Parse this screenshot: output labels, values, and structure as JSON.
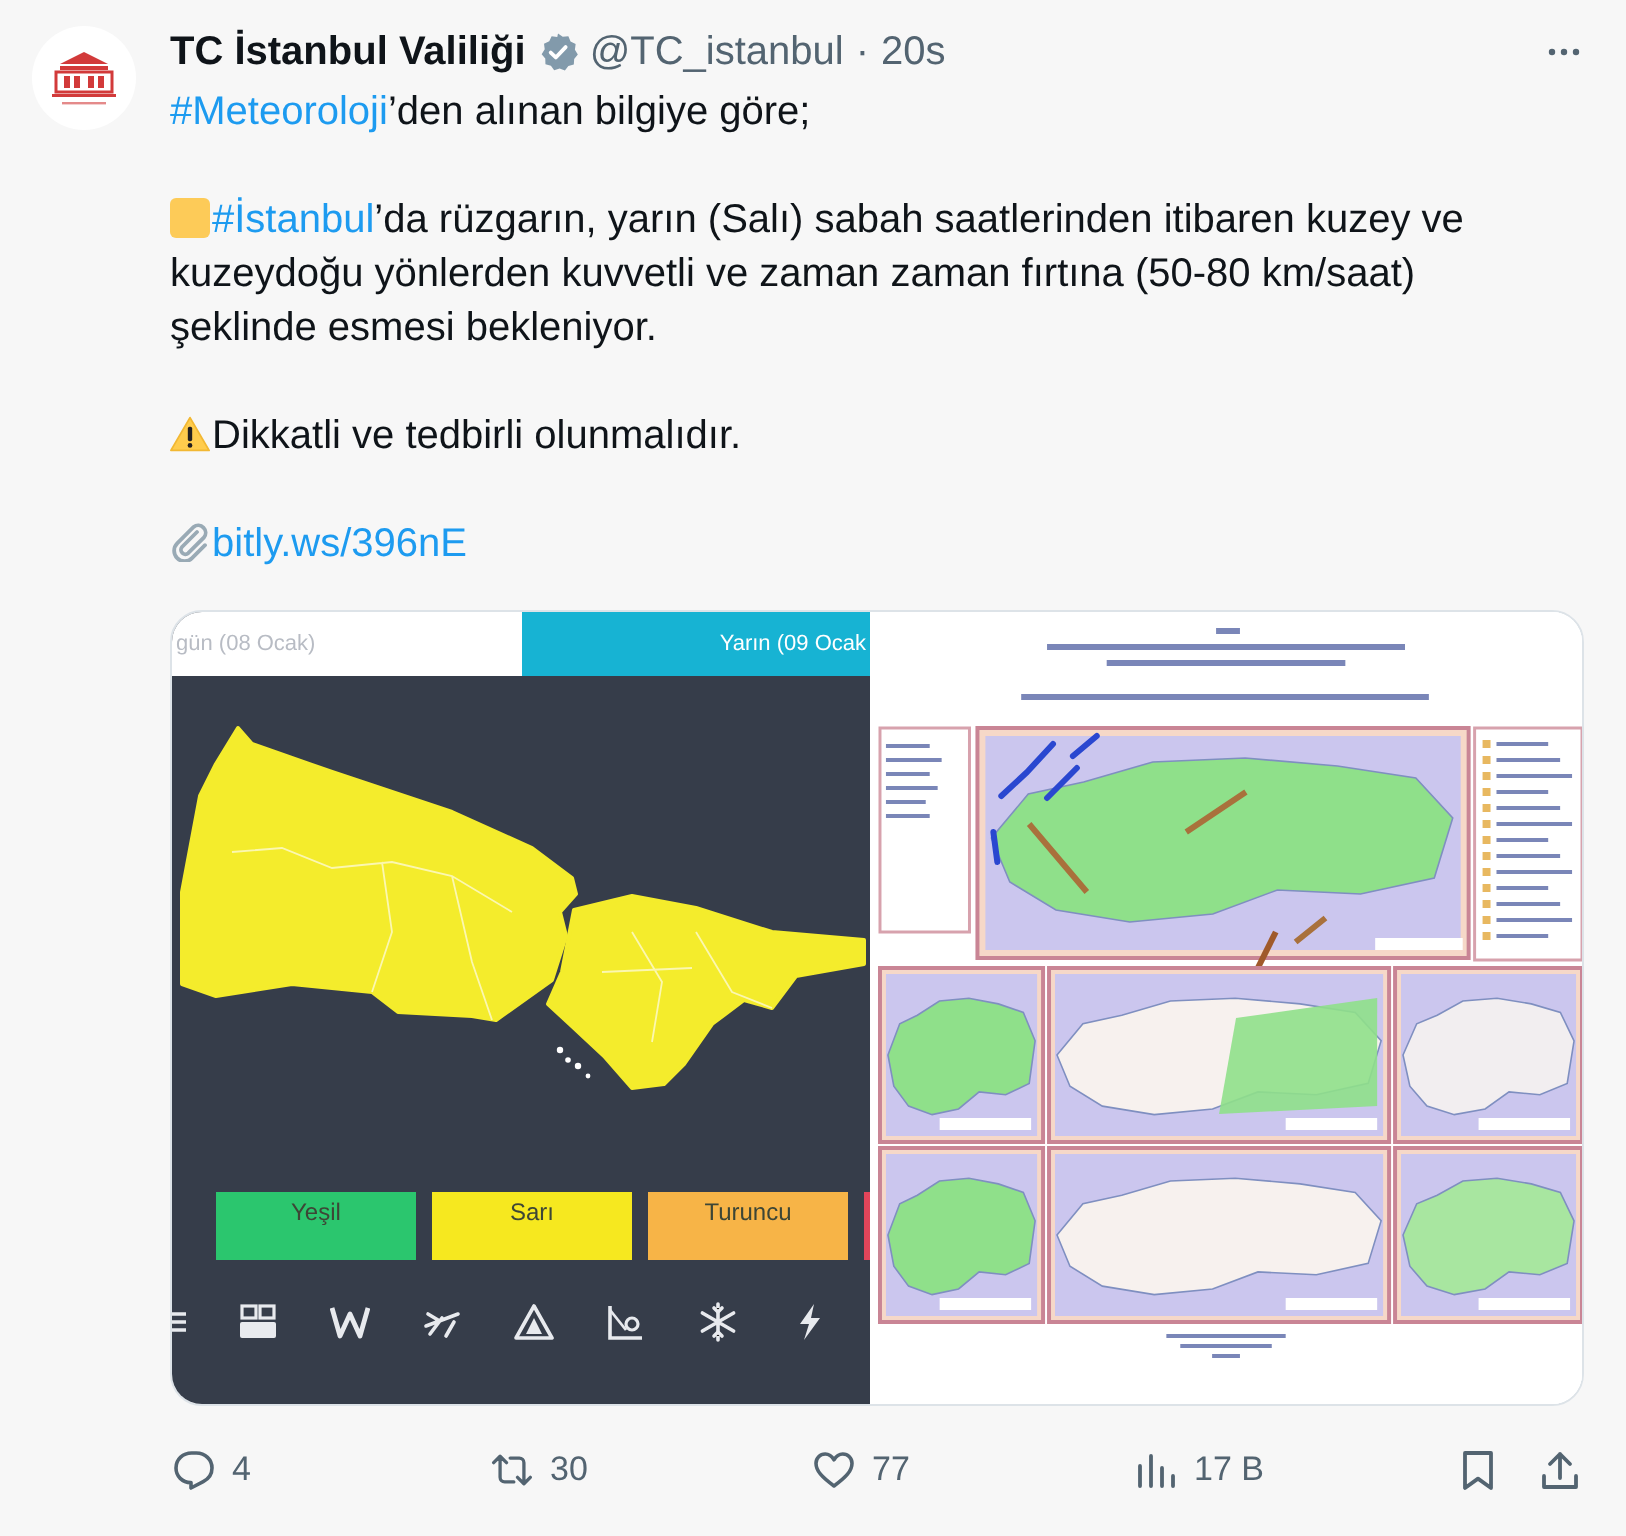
{
  "author": {
    "name": "TC İstanbul Valiliği",
    "verified": true,
    "handle": "@TC_istanbul",
    "separator": "·",
    "time": "20s"
  },
  "paragraphs": [
    {
      "kind": "plain",
      "segments": [
        {
          "kind": "hashtag",
          "text": "#Meteoroloji"
        },
        {
          "kind": "text",
          "text": "’den alınan bilgiye göre;"
        }
      ]
    },
    {
      "kind": "alert",
      "segments": [
        {
          "kind": "hashtag",
          "text": "#İstanbul"
        },
        {
          "kind": "text",
          "text": "’da rüzgarın, yarın (Salı) sabah saatlerinden itibaren kuzey ve kuzeydoğu yönlerden kuvvetli ve zaman zaman fırtına (50-80 km/saat) şeklinde esmesi bekleniyor."
        }
      ]
    },
    {
      "kind": "warning",
      "segments": [
        {
          "kind": "text",
          "text": "Dikkatli ve tedbirli olunmalıdır."
        }
      ]
    },
    {
      "kind": "attachment",
      "segments": [
        {
          "kind": "link",
          "text": "bitly.ws/396nE"
        }
      ]
    }
  ],
  "media": {
    "warning_map": {
      "tabs": [
        {
          "label": "gün (08 Ocak)",
          "selected": false
        },
        {
          "label": "Yarın (09 Ocak",
          "selected": true
        }
      ],
      "legend": [
        {
          "label": "Yeşil",
          "color": "#2bc66e"
        },
        {
          "label": "Sarı",
          "color": "#f6e81f"
        },
        {
          "label": "Turuncu",
          "color": "#f7b447"
        },
        {
          "color": "#e2455a"
        }
      ]
    }
  },
  "actions": [
    {
      "kind": "reply",
      "count": "4"
    },
    {
      "kind": "repost",
      "count": "30"
    },
    {
      "kind": "like",
      "count": "77"
    },
    {
      "kind": "views",
      "count": "17 B"
    },
    {
      "kind": "bookmark"
    },
    {
      "kind": "share"
    }
  ]
}
